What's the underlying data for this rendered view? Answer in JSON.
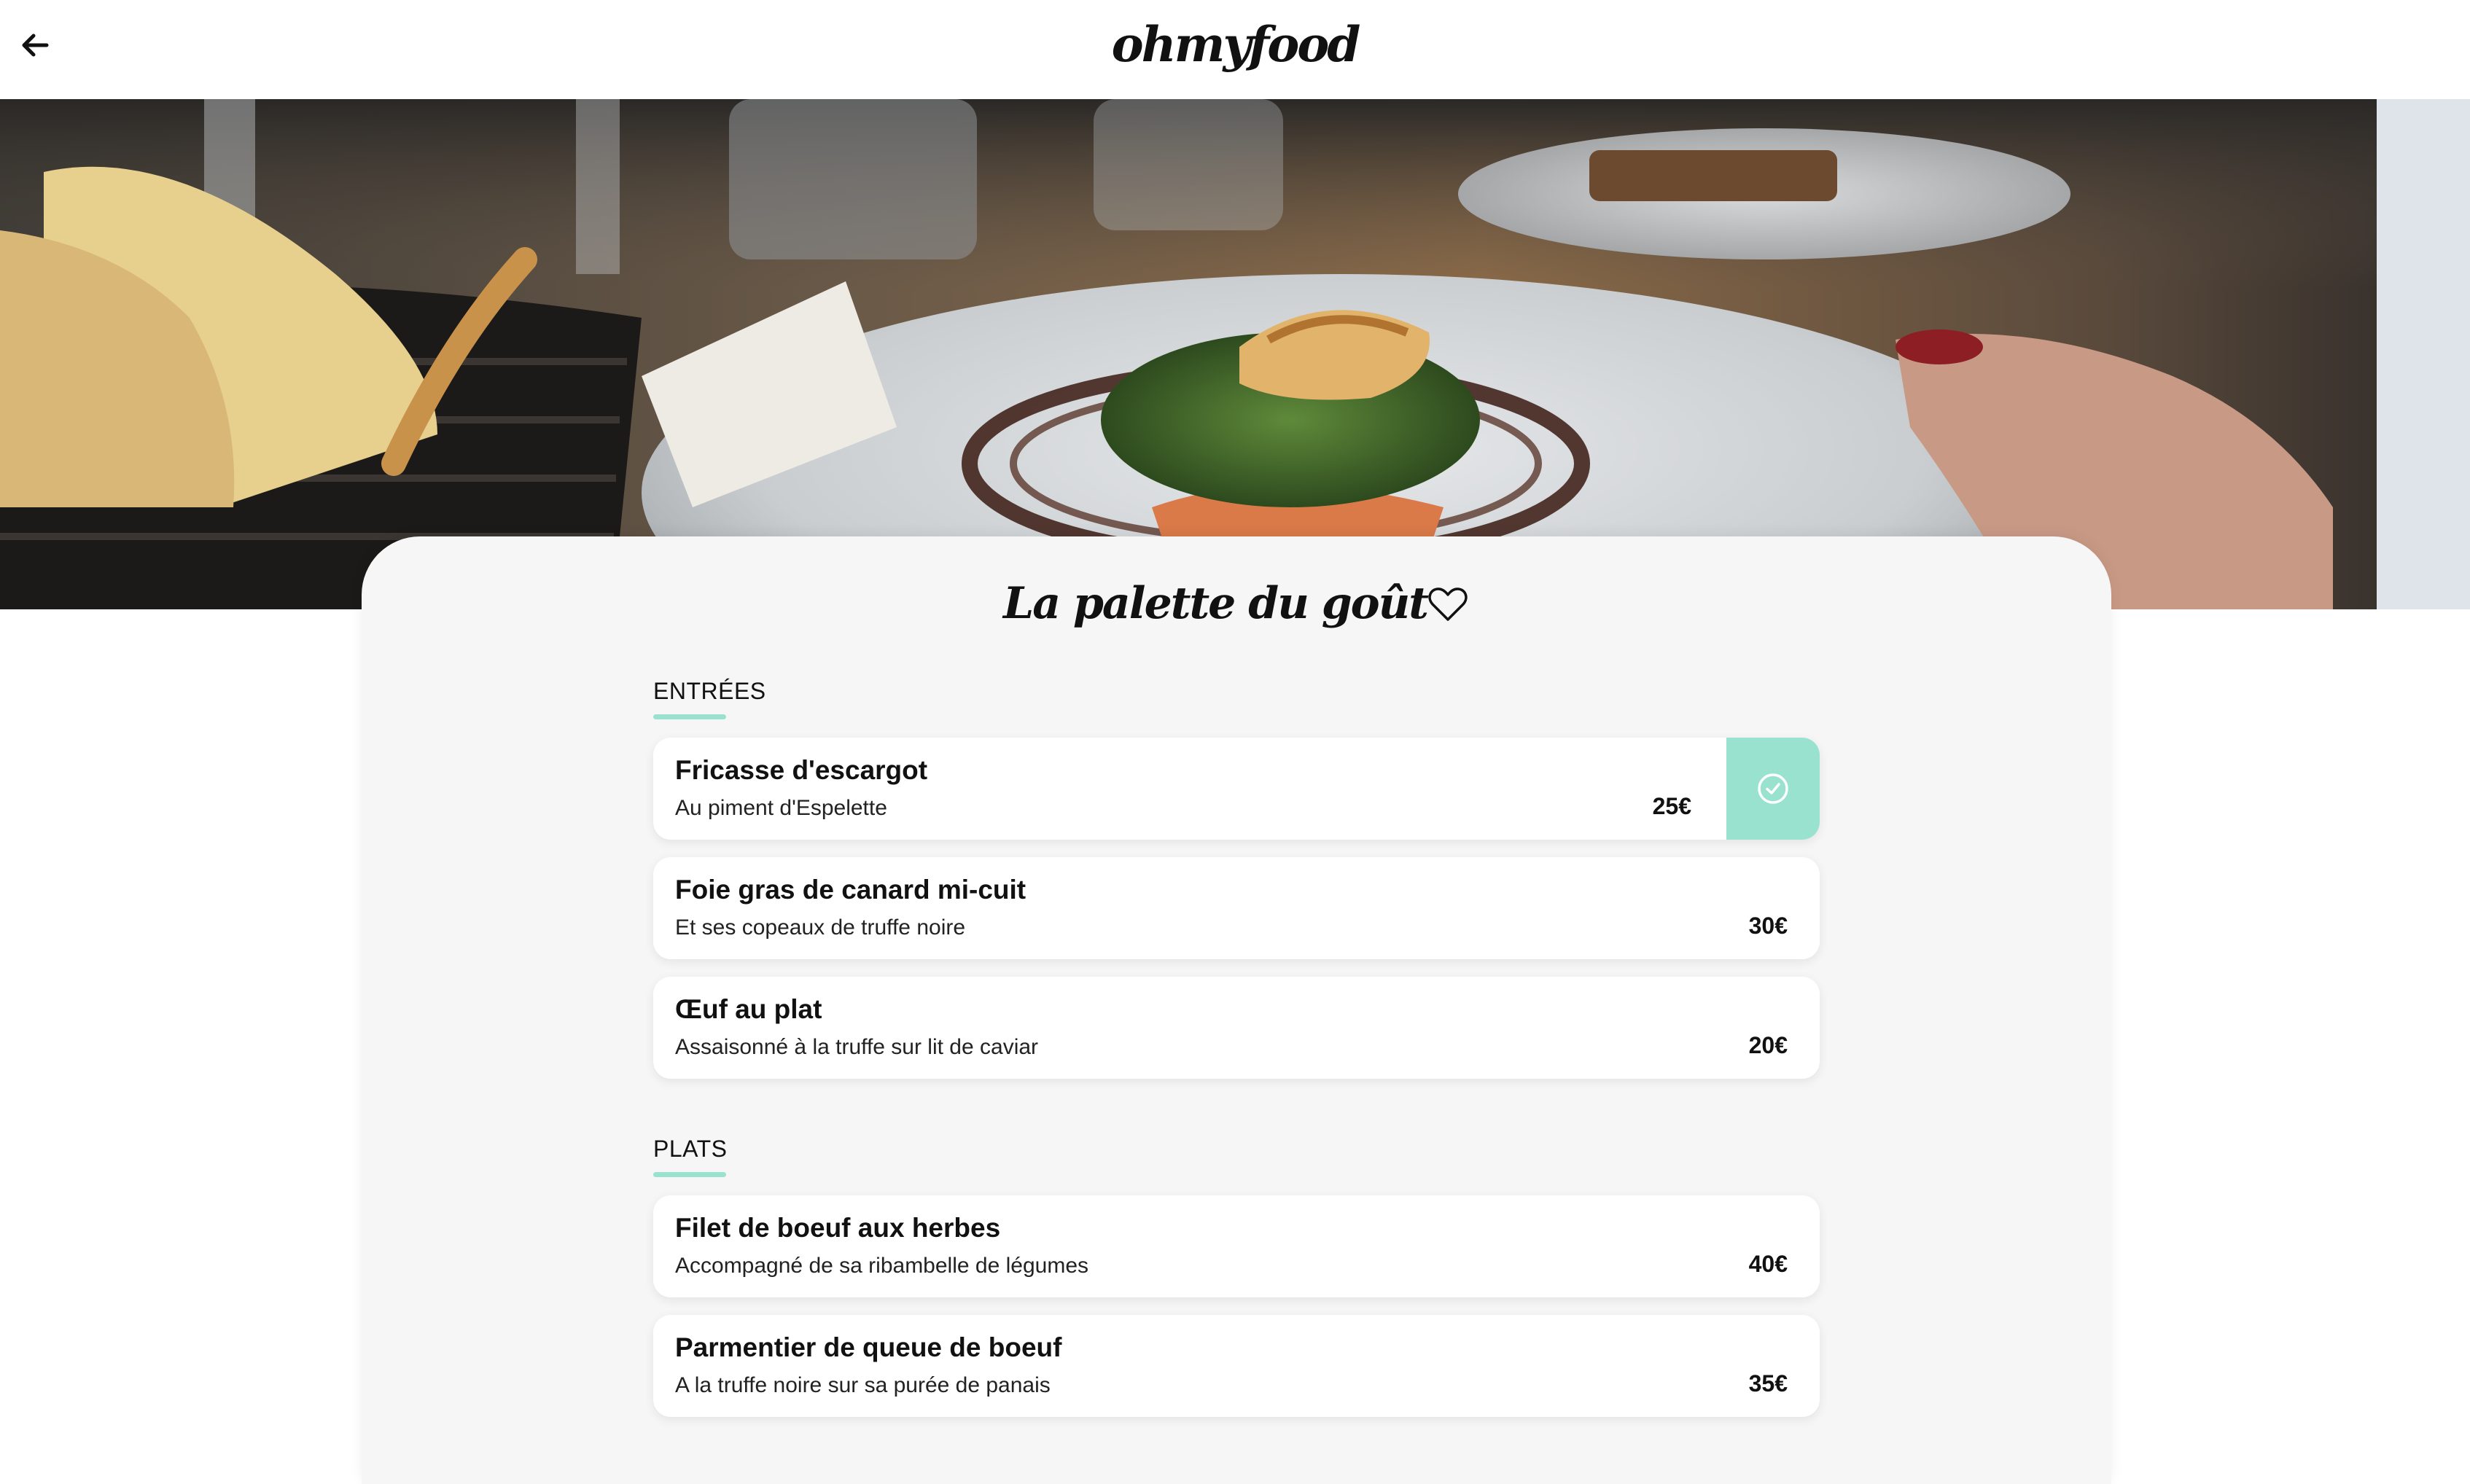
{
  "header": {
    "back_icon": "arrow-left-icon",
    "logo": "ohmyfood"
  },
  "hero": {
    "image": "plated-fish-dish-photo"
  },
  "restaurant": {
    "name": "La palette du goût",
    "favorite_icon": "heart-outline-icon"
  },
  "colors": {
    "accent": "#99e2d0",
    "card_bg": "#f6f6f6",
    "text": "#111111"
  },
  "sections": [
    {
      "title": "ENTRÉES",
      "dishes": [
        {
          "name": "Fricasse d'escargot",
          "description": "Au piment d'Espelette",
          "price": "25€",
          "selected": true
        },
        {
          "name": "Foie gras de canard mi-cuit",
          "description": "Et ses copeaux de truffe noire",
          "price": "30€",
          "selected": false
        },
        {
          "name": "Œuf au plat",
          "description": "Assaisonné à la truffe sur lit de caviar",
          "price": "20€",
          "selected": false
        }
      ]
    },
    {
      "title": "PLATS",
      "dishes": [
        {
          "name": "Filet de boeuf aux herbes",
          "description": "Accompagné de sa ribambelle de légumes",
          "price": "40€",
          "selected": false
        },
        {
          "name": "Parmentier de queue de boeuf",
          "description": "A la truffe noire sur sa purée de panais",
          "price": "35€",
          "selected": false
        }
      ]
    }
  ]
}
